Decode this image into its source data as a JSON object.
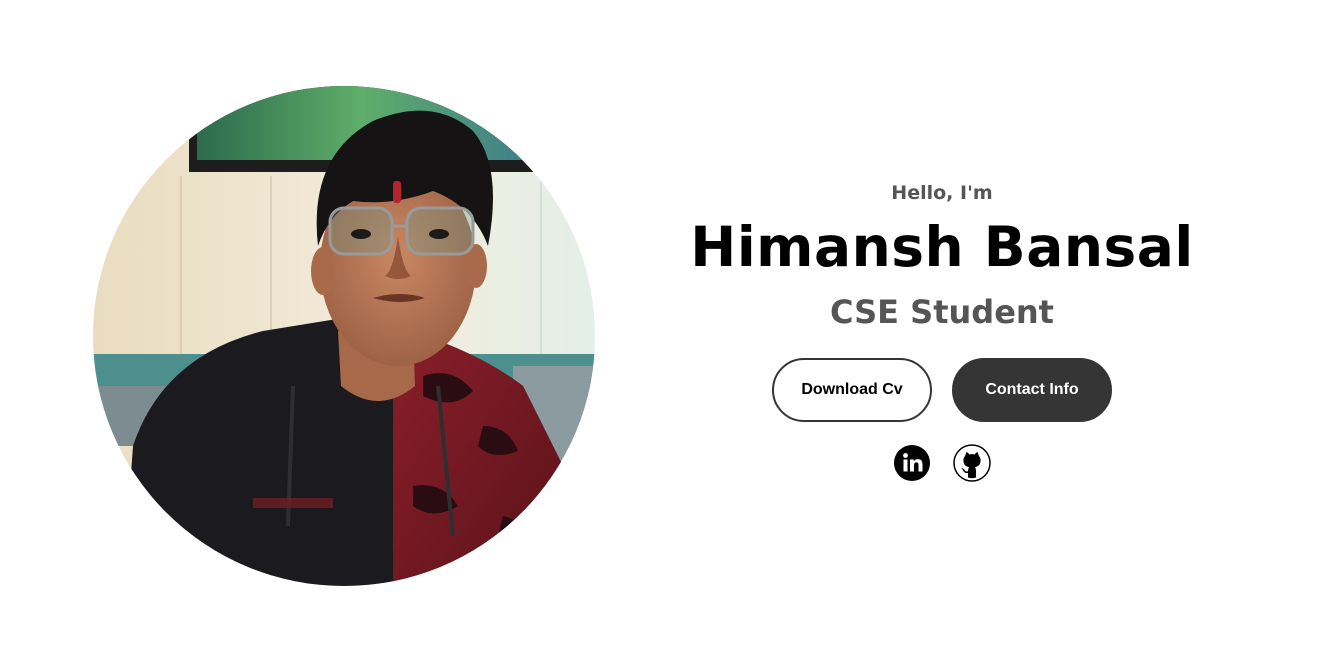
{
  "profile": {
    "greeting": "Hello, I'm",
    "name": "Himansh Bansal",
    "role": "CSE Student",
    "photo_alt": "Himansh Bansal profile picture"
  },
  "buttons": {
    "download_cv": "Download Cv",
    "contact_info": "Contact Info"
  },
  "socials": [
    {
      "icon": "linkedin-icon",
      "label": "My LinkedIn profile"
    },
    {
      "icon": "github-icon",
      "label": "My Github profile"
    }
  ],
  "colors": {
    "background": "#ffffff",
    "text_primary": "#000000",
    "text_secondary": "#555555",
    "button_dark": "#353535"
  }
}
